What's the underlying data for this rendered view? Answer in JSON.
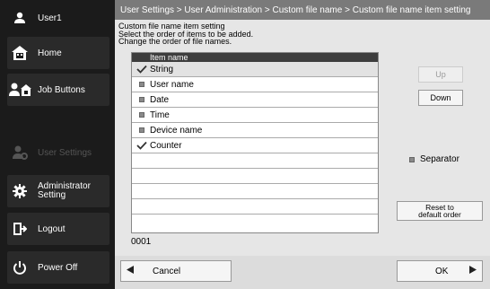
{
  "sidebar": {
    "user": "User1",
    "home": "Home",
    "job_buttons": "Job Buttons",
    "user_settings": "User Settings",
    "admin_line1": "Administrator",
    "admin_line2": "Setting",
    "logout": "Logout",
    "power_off": "Power Off"
  },
  "breadcrumb": "User Settings > User Administration > Custom file name > Custom file name item setting",
  "instructions": {
    "line1": "Custom file name item setting",
    "line2": "Select the order of items to be added.",
    "line3": "Change the order of file names."
  },
  "list": {
    "header": "Item name",
    "items": [
      {
        "label": "String",
        "checked": true,
        "selected": true
      },
      {
        "label": "User name",
        "checked": false,
        "selected": false
      },
      {
        "label": "Date",
        "checked": false,
        "selected": false
      },
      {
        "label": "Time",
        "checked": false,
        "selected": false
      },
      {
        "label": "Device name",
        "checked": false,
        "selected": false
      },
      {
        "label": "Counter",
        "checked": true,
        "selected": false
      }
    ],
    "counter": "0001"
  },
  "buttons": {
    "up": "Up",
    "down": "Down",
    "separator": "Separator",
    "reset_line1": "Reset to",
    "reset_line2": "default order",
    "cancel": "Cancel",
    "ok": "OK"
  }
}
